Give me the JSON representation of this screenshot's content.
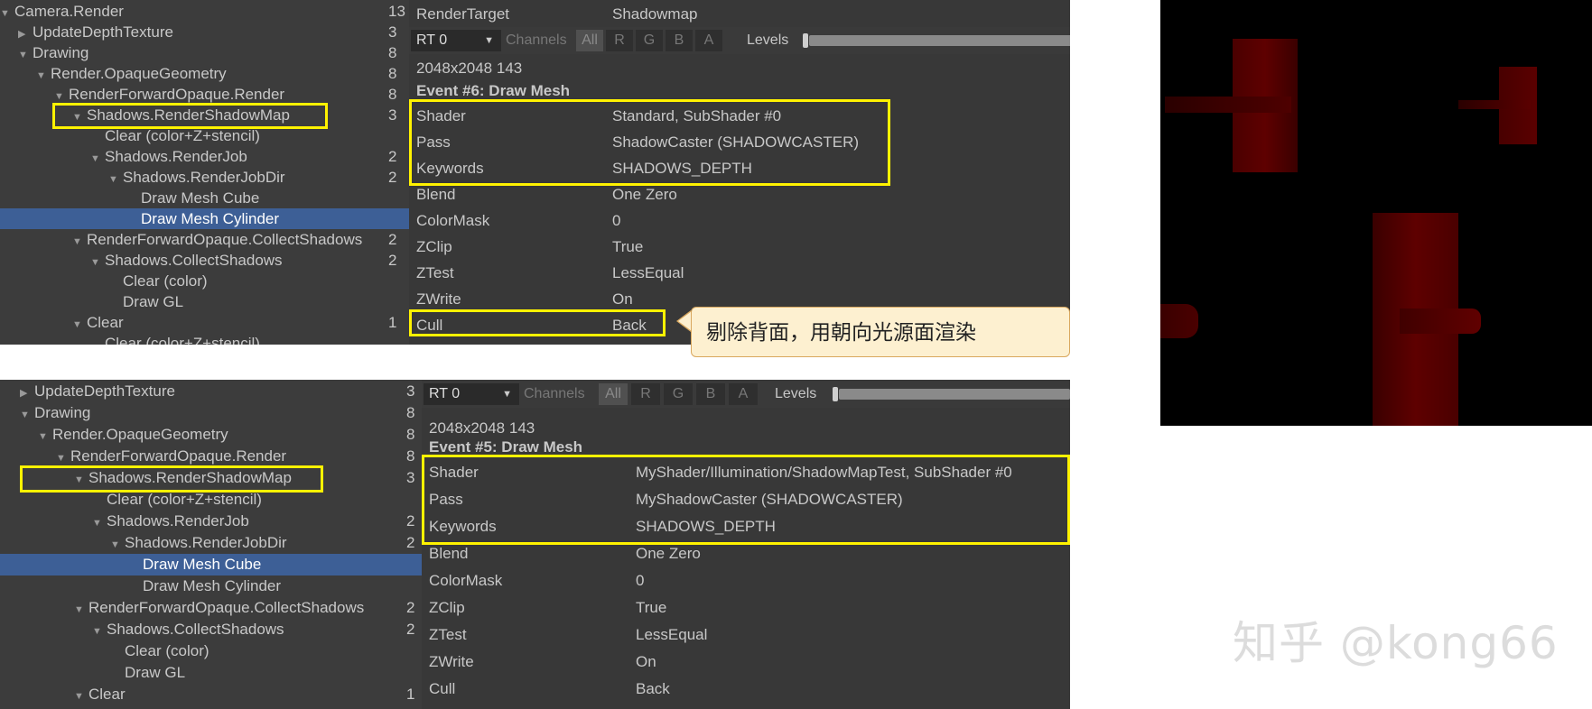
{
  "top": {
    "tree": [
      {
        "label": "Camera.Render",
        "count": "13",
        "indent": 0,
        "arrow": "open"
      },
      {
        "label": "UpdateDepthTexture",
        "count": "3",
        "indent": 1,
        "arrow": "closed"
      },
      {
        "label": "Drawing",
        "count": "8",
        "indent": 1,
        "arrow": "open"
      },
      {
        "label": "Render.OpaqueGeometry",
        "count": "8",
        "indent": 2,
        "arrow": "open"
      },
      {
        "label": "RenderForwardOpaque.Render",
        "count": "8",
        "indent": 3,
        "arrow": "open"
      },
      {
        "label": "Shadows.RenderShadowMap",
        "count": "3",
        "indent": 4,
        "arrow": "open"
      },
      {
        "label": "Clear (color+Z+stencil)",
        "count": "",
        "indent": 5,
        "arrow": ""
      },
      {
        "label": "Shadows.RenderJob",
        "count": "2",
        "indent": 5,
        "arrow": "open"
      },
      {
        "label": "Shadows.RenderJobDir",
        "count": "2",
        "indent": 6,
        "arrow": "open"
      },
      {
        "label": "Draw Mesh Cube",
        "count": "",
        "indent": 7,
        "arrow": ""
      },
      {
        "label": "Draw Mesh Cylinder",
        "count": "",
        "indent": 7,
        "arrow": "",
        "selected": true
      },
      {
        "label": "RenderForwardOpaque.CollectShadows",
        "count": "2",
        "indent": 4,
        "arrow": "open"
      },
      {
        "label": "Shadows.CollectShadows",
        "count": "2",
        "indent": 5,
        "arrow": "open"
      },
      {
        "label": "Clear (color)",
        "count": "",
        "indent": 6,
        "arrow": ""
      },
      {
        "label": "Draw GL",
        "count": "",
        "indent": 6,
        "arrow": ""
      },
      {
        "label": "Clear",
        "count": "1",
        "indent": 4,
        "arrow": "open"
      },
      {
        "label": "Clear (color+Z+stencil)",
        "count": "",
        "indent": 5,
        "arrow": ""
      }
    ],
    "render_target_label": "RenderTarget",
    "render_target_value": "Shadowmap",
    "rt_select": "RT 0",
    "channels_label": "Channels",
    "channel_buttons": [
      "All",
      "R",
      "G",
      "B",
      "A"
    ],
    "levels_label": "Levels",
    "resolution": "2048x2048 143",
    "event_title": "Event #6: Draw Mesh",
    "properties": [
      {
        "key": "Shader",
        "value": "Standard, SubShader #0"
      },
      {
        "key": "Pass",
        "value": "ShadowCaster (SHADOWCASTER)"
      },
      {
        "key": "Keywords",
        "value": "SHADOWS_DEPTH"
      },
      {
        "key": "Blend",
        "value": "One Zero"
      },
      {
        "key": "ColorMask",
        "value": "0"
      },
      {
        "key": "ZClip",
        "value": "True"
      },
      {
        "key": "ZTest",
        "value": "LessEqual"
      },
      {
        "key": "ZWrite",
        "value": "On"
      },
      {
        "key": "Cull",
        "value": "Back"
      }
    ],
    "callout_text": "剔除背面，用朝向光源面渲染"
  },
  "bottom": {
    "tree": [
      {
        "label": "UpdateDepthTexture",
        "count": "3",
        "indent": 1,
        "arrow": "closed"
      },
      {
        "label": "Drawing",
        "count": "8",
        "indent": 1,
        "arrow": "open"
      },
      {
        "label": "Render.OpaqueGeometry",
        "count": "8",
        "indent": 2,
        "arrow": "open"
      },
      {
        "label": "RenderForwardOpaque.Render",
        "count": "8",
        "indent": 3,
        "arrow": "open"
      },
      {
        "label": "Shadows.RenderShadowMap",
        "count": "3",
        "indent": 4,
        "arrow": "open"
      },
      {
        "label": "Clear (color+Z+stencil)",
        "count": "",
        "indent": 5,
        "arrow": ""
      },
      {
        "label": "Shadows.RenderJob",
        "count": "2",
        "indent": 5,
        "arrow": "open"
      },
      {
        "label": "Shadows.RenderJobDir",
        "count": "2",
        "indent": 6,
        "arrow": "open"
      },
      {
        "label": "Draw Mesh Cube",
        "count": "",
        "indent": 7,
        "arrow": "",
        "selected": true
      },
      {
        "label": "Draw Mesh Cylinder",
        "count": "",
        "indent": 7,
        "arrow": ""
      },
      {
        "label": "RenderForwardOpaque.CollectShadows",
        "count": "2",
        "indent": 4,
        "arrow": "open"
      },
      {
        "label": "Shadows.CollectShadows",
        "count": "2",
        "indent": 5,
        "arrow": "open"
      },
      {
        "label": "Clear (color)",
        "count": "",
        "indent": 6,
        "arrow": ""
      },
      {
        "label": "Draw GL",
        "count": "",
        "indent": 6,
        "arrow": ""
      },
      {
        "label": "Clear",
        "count": "1",
        "indent": 4,
        "arrow": "open"
      }
    ],
    "rt_select": "RT 0",
    "channels_label": "Channels",
    "channel_buttons": [
      "All",
      "R",
      "G",
      "B",
      "A"
    ],
    "levels_label": "Levels",
    "resolution": "2048x2048 143",
    "event_title": "Event #5: Draw Mesh",
    "properties": [
      {
        "key": "Shader",
        "value": "MyShader/Illumination/ShadowMapTest, SubShader #0"
      },
      {
        "key": "Pass",
        "value": "MyShadowCaster (SHADOWCASTER)"
      },
      {
        "key": "Keywords",
        "value": "SHADOWS_DEPTH"
      },
      {
        "key": "Blend",
        "value": "One Zero"
      },
      {
        "key": "ColorMask",
        "value": "0"
      },
      {
        "key": "ZClip",
        "value": "True"
      },
      {
        "key": "ZTest",
        "value": "LessEqual"
      },
      {
        "key": "ZWrite",
        "value": "On"
      },
      {
        "key": "Cull",
        "value": "Back"
      }
    ]
  },
  "watermark": "知乎 @kong66",
  "colors": {
    "panel_bg": "#383838",
    "selection": "#3d5f96",
    "highlight_box": "#fff200",
    "shadow_red": "#5a0000"
  }
}
